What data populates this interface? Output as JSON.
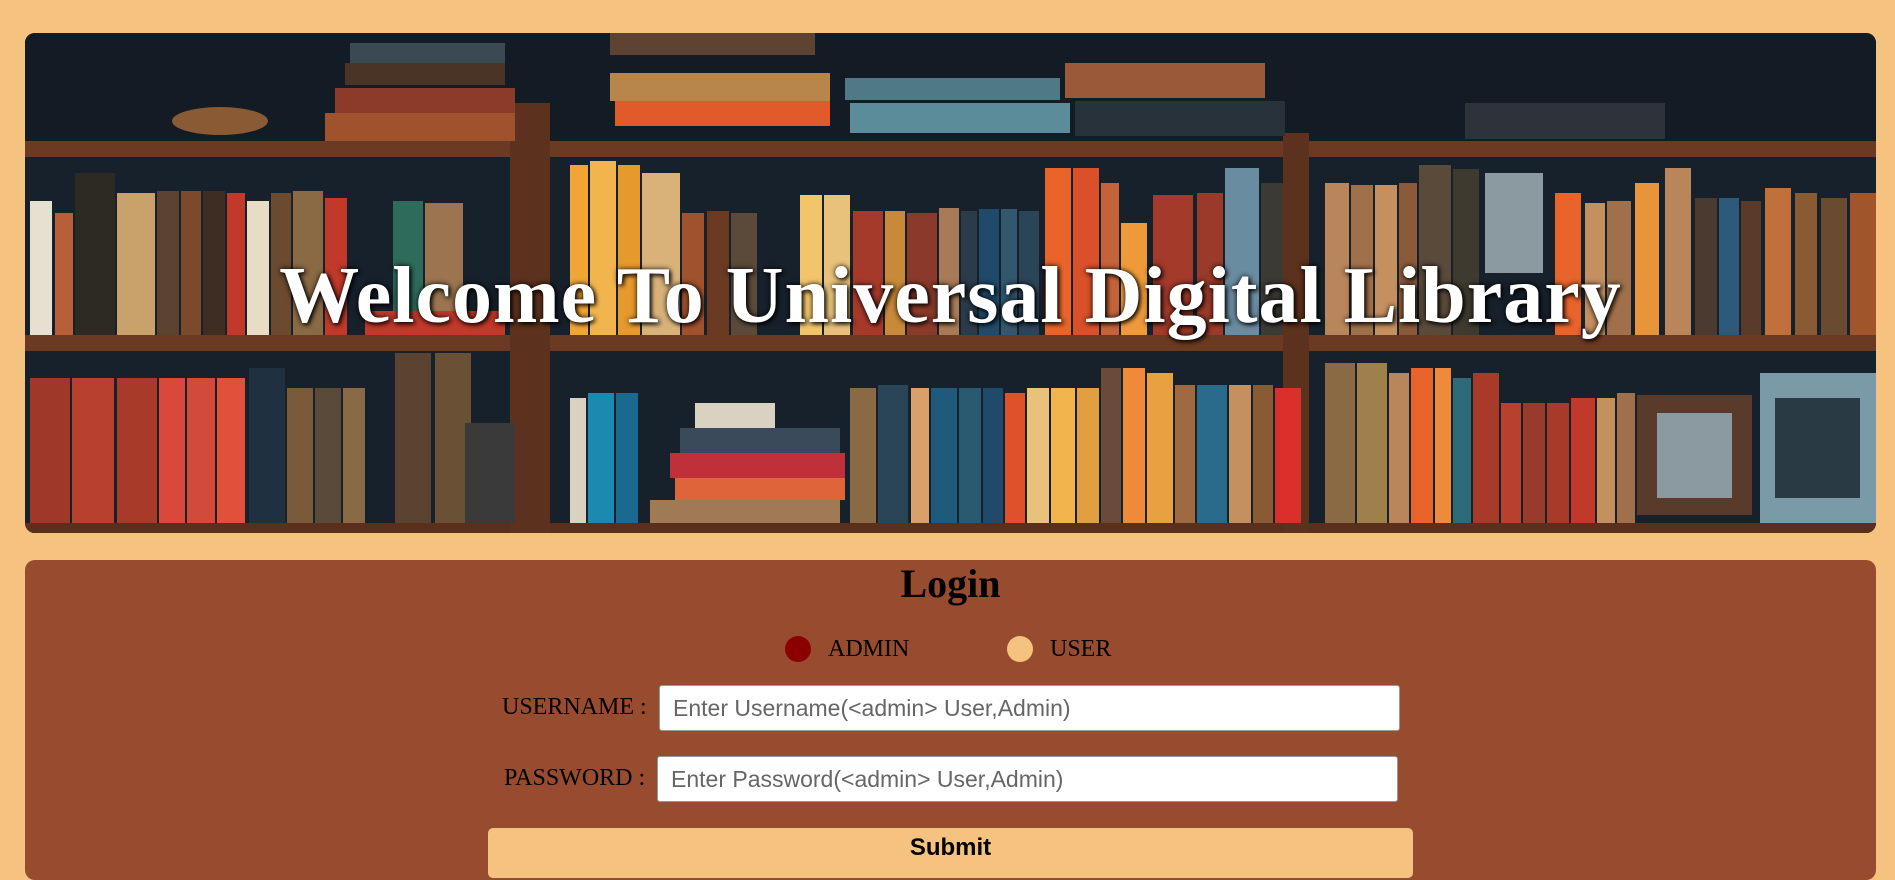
{
  "hero": {
    "title": "Welcome To Universal Digital Library",
    "image": "bookshelf-illustration"
  },
  "login": {
    "title": "Login",
    "roles": [
      {
        "label": "ADMIN",
        "selected": true,
        "color": "#8b0000"
      },
      {
        "label": "USER",
        "selected": false,
        "color": "#f6c27f"
      }
    ],
    "username_label": "USERNAME :",
    "username_placeholder": "Enter Username(<admin> User,Admin)",
    "password_label": "PASSWORD :",
    "password_placeholder": "Enter Password(<admin> User,Admin)",
    "submit_label": "Submit"
  },
  "colors": {
    "page_bg": "#f6c27f",
    "panel_bg": "#974b2f",
    "hero_bg": "#17212c"
  }
}
